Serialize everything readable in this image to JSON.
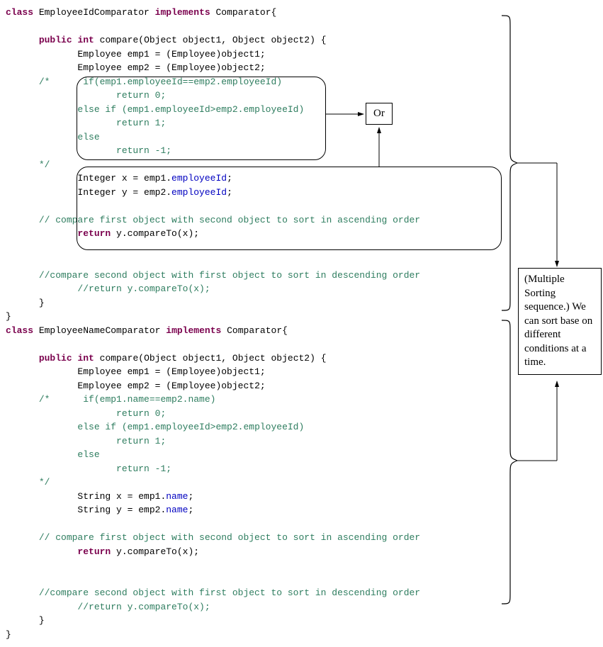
{
  "diagram": {
    "or_label": "Or",
    "note": "(Multiple Sorting sequence.) We can sort base on different conditions at a time."
  },
  "code": {
    "c1": {
      "decl_class": "class",
      "decl_name": "EmployeeIdComparator",
      "decl_impl": "implements",
      "decl_iface": "Comparator{",
      "m_public": "public",
      "m_int": "int",
      "m_sig": "compare(Object object1, Object object2) {",
      "l1": "Employee emp1 = (Employee)object1;",
      "l2": "Employee emp2 = (Employee)object2;",
      "bc_open": "/*",
      "bc1": "if(emp1.employeeId==emp2.employeeId)",
      "bc2": "return 0;",
      "bc3": "else if (emp1.employeeId>emp2.employeeId)",
      "bc4": "return 1;",
      "bc5": "else",
      "bc6": "return -1;",
      "bc_close": "*/",
      "ix_a": "Integer x = emp1.",
      "ix_b": "employeeId",
      "ix_c": ";",
      "iy_a": "Integer y = emp2.",
      "iy_b": "employeeId",
      "iy_c": ";",
      "cc1": "// compare first object with second object to sort in ascending order",
      "ret_kw": "return",
      "ret_expr": " y.compareTo(x);",
      "cc2": "//compare second object with first object to sort in descending order",
      "cc3": "//return y.compareTo(x);",
      "brace_m": "}",
      "brace_c": "}"
    },
    "c2": {
      "decl_class": "class",
      "decl_name": "EmployeeNameComparator",
      "decl_impl": "implements",
      "decl_iface": "Comparator{",
      "m_public": "public",
      "m_int": "int",
      "m_sig": "compare(Object object1, Object object2) {",
      "l1": "Employee emp1 = (Employee)object1;",
      "l2": "Employee emp2 = (Employee)object2;",
      "bc_open": "/*",
      "bc1": "if(emp1.name==emp2.name)",
      "bc2": "return 0;",
      "bc3": "else if (emp1.employeeId>emp2.employeeId)",
      "bc4": "return 1;",
      "bc5": "else",
      "bc6": "return -1;",
      "bc_close": "*/",
      "ix_a": "String x = emp1.",
      "ix_b": "name",
      "ix_c": ";",
      "iy_a": "String y = emp2.",
      "iy_b": "name",
      "iy_c": ";",
      "cc1": "// compare first object with second object to sort in ascending order",
      "ret_kw": "return",
      "ret_expr": " y.compareTo(x);",
      "cc2": "//compare second object with first object to sort in descending order",
      "cc3": "//return y.compareTo(x);",
      "brace_m": "}",
      "brace_c": "}"
    }
  }
}
